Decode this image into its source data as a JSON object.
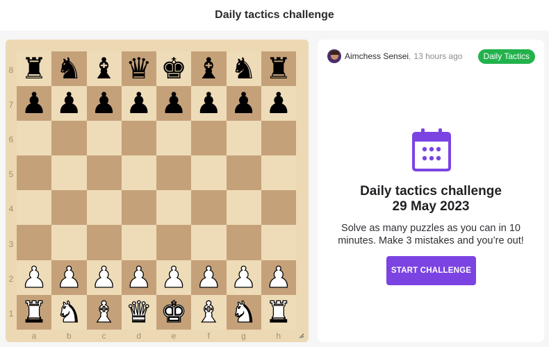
{
  "page": {
    "title": "Daily tactics challenge"
  },
  "board": {
    "ranks": [
      "8",
      "7",
      "6",
      "5",
      "4",
      "3",
      "2",
      "1"
    ],
    "files": [
      "a",
      "b",
      "c",
      "d",
      "e",
      "f",
      "g",
      "h"
    ],
    "squares": [
      [
        "br",
        "bn",
        "bb",
        "bq",
        "bk",
        "bb",
        "bn",
        "br"
      ],
      [
        "bp",
        "bp",
        "bp",
        "bp",
        "bp",
        "bp",
        "bp",
        "bp"
      ],
      [
        "",
        "",
        "",
        "",
        "",
        "",
        "",
        ""
      ],
      [
        "",
        "",
        "",
        "",
        "",
        "",
        "",
        ""
      ],
      [
        "",
        "",
        "",
        "",
        "",
        "",
        "",
        ""
      ],
      [
        "",
        "",
        "",
        "",
        "",
        "",
        "",
        ""
      ],
      [
        "wp",
        "wp",
        "wp",
        "wp",
        "wp",
        "wp",
        "wp",
        "wp"
      ],
      [
        "wr",
        "wn",
        "wb",
        "wq",
        "wk",
        "wb",
        "wn",
        "wr"
      ]
    ],
    "colors": {
      "light": "#eedcb8",
      "dark": "#c5a17a"
    }
  },
  "card": {
    "author": "Aimchess Sensei",
    "separator": ",",
    "time": "13 hours ago",
    "tag": "Daily Tactics",
    "icon": "calendar-icon",
    "title_line1": "Daily tactics challenge",
    "title_line2": "29 May 2023",
    "description": "Solve as many puzzles as you can in 10 minutes. Make 3 mistakes and you’re out!",
    "button_label": "START CHALLENGE",
    "colors": {
      "accent": "#7b44e2",
      "tag": "#22b24c"
    }
  }
}
